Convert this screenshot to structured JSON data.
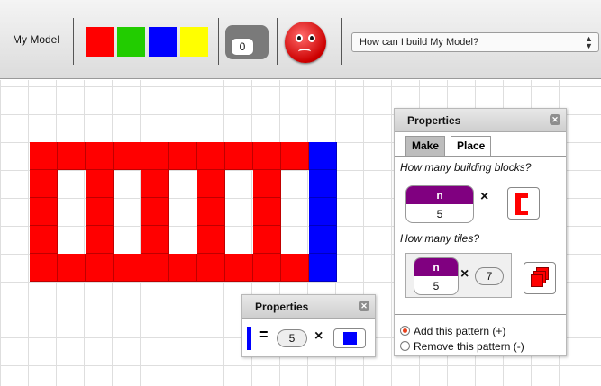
{
  "toolbar": {
    "model_label": "My Model",
    "colors": [
      "#ff0000",
      "#22cc00",
      "#0000ff",
      "#ffff00"
    ],
    "counter_value": "0",
    "mood": "sad",
    "question_select": "How can I build My Model?"
  },
  "panel_small": {
    "title": "Properties",
    "equals": "=",
    "count": "5",
    "times": "×"
  },
  "panel_big": {
    "title": "Properties",
    "tabs": [
      "Make",
      "Place"
    ],
    "q_blocks": "How many building blocks?",
    "var_name": "n",
    "var_value": "5",
    "times": "×",
    "q_tiles": "How many tiles?",
    "tile_var_name": "n",
    "tile_var_value": "5",
    "tile_multiplier": "7",
    "options": {
      "add": "Add this pattern (+)",
      "remove": "Remove this pattern (-)"
    },
    "selected_option": "add"
  }
}
